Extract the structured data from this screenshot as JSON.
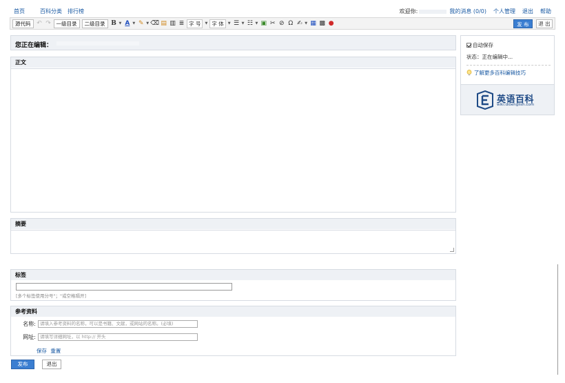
{
  "topnav": {
    "left": [
      "首页",
      "百科分类",
      "排行榜"
    ],
    "welcome": "欢迎你:",
    "messages": "我的消息 (0/0)",
    "manage": "个人管理",
    "logout": "退出",
    "help": "帮助"
  },
  "toolbar": {
    "source": "源代码",
    "undo_icon": "undo-icon",
    "redo_icon": "redo-icon",
    "h1": "一级目录",
    "h2": "二级目录",
    "bold": "B",
    "font_color": "A",
    "font_size": "字 号",
    "font_family": "字 体",
    "publish": "发 布",
    "exit": "退 出"
  },
  "editor": {
    "editing_label": "您正在编辑：",
    "body_label": "正文",
    "summary_label": "摘要",
    "tags_label": "标签",
    "tags_hint": "[多个标签使用分号\"；\"或空格隔开]",
    "ref_label": "参考资料",
    "ref_name_label": "名称:",
    "ref_name_placeholder": "请填入参考资料的名称，可以是书籍、文献，或网站的名称。(必填)",
    "ref_url_label": "网址:",
    "ref_url_placeholder": "请填写详细网址，以 http:// 开头",
    "ref_save": "保存",
    "ref_reset": "重置",
    "publish": "发布",
    "exit": "退出"
  },
  "sidebar": {
    "autosave": "自动保存",
    "status": "状态：正在编辑中...",
    "tips": "了解更多百科编辑技巧",
    "logo_cn": "英语百科",
    "logo_en": "wiki.dioenglish.com"
  },
  "colors": {
    "accent": "#3b7ed1",
    "link": "#1a5aa3",
    "panel_head": "#eef1f5"
  }
}
